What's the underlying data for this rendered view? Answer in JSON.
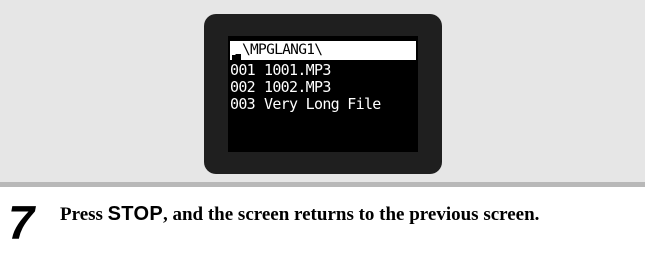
{
  "display": {
    "path": "\\MPGLANG1\\",
    "folder_icon": "folder-icon",
    "files": [
      {
        "number": "001",
        "name": "1001.MP3"
      },
      {
        "number": "002",
        "name": "1002.MP3"
      },
      {
        "number": "003",
        "name": "Very Long File"
      }
    ],
    "colors": {
      "screen_background": "#000000",
      "screen_text": "#ffffff",
      "header_background": "#ffffff",
      "bezel": "#1f1f1f",
      "panel_background": "#e6e6e6"
    }
  },
  "step": {
    "number": "7",
    "text_before": "Press ",
    "key_label": "STOP",
    "text_after": ", and the screen returns to the previous screen."
  }
}
